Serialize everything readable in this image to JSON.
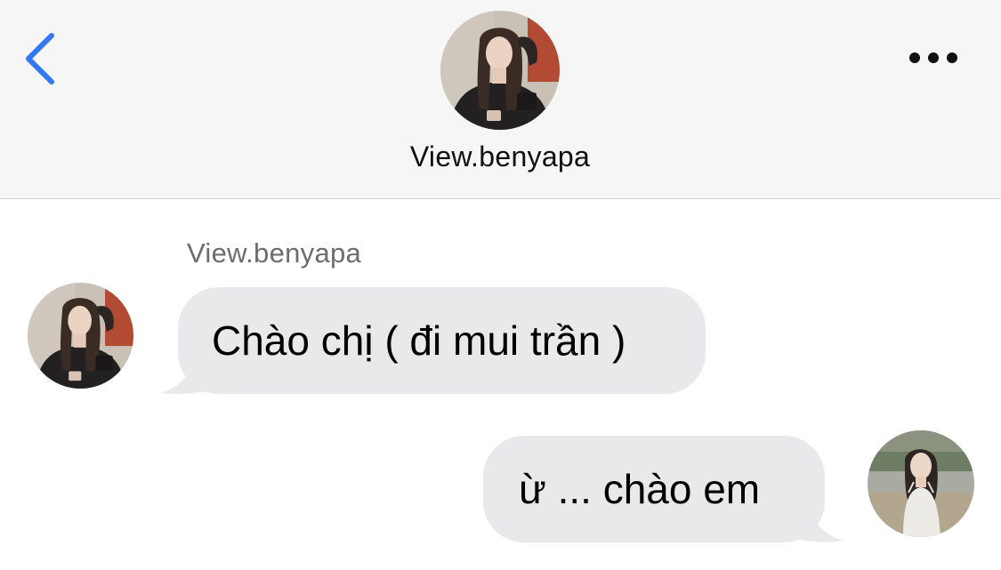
{
  "header": {
    "contact_name": "View.benyapa",
    "back_icon": "chevron-left-icon",
    "more_icon": "ellipsis-icon"
  },
  "conversation": {
    "sender_name": "View.benyapa",
    "messages": [
      {
        "direction": "incoming",
        "text": "Chào chị ( đi mui trần )"
      },
      {
        "direction": "outgoing",
        "text": "ừ ... chào em"
      }
    ]
  },
  "colors": {
    "accent": "#3478f6",
    "bubble": "#e9e9eb",
    "header_bg": "#f6f6f6"
  }
}
